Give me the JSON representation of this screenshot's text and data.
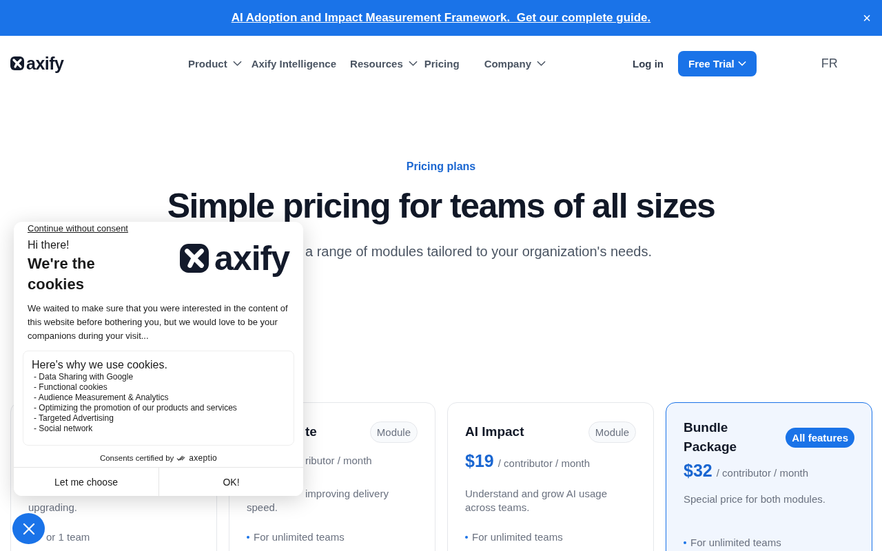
{
  "banner": {
    "link": "AI Adoption and Impact Measurement Framework.  Get our complete guide.",
    "close": "×"
  },
  "nav": {
    "logo": "axify",
    "items": [
      {
        "label": "Product",
        "dropdown": true
      },
      {
        "label": "Axify Intelligence",
        "dropdown": false
      },
      {
        "label": "Resources",
        "dropdown": true
      },
      {
        "label": "Pricing",
        "dropdown": false
      },
      {
        "label": "Company",
        "dropdown": true
      }
    ],
    "login": "Log in",
    "trial": "Free Trial",
    "language": "FR"
  },
  "hero": {
    "eyebrow": "Pricing plans",
    "title": "Simple pricing for teams of all sizes",
    "subtitle": "a range of modules tailored to your organization's needs."
  },
  "plans": [
    {
      "highlighted": false,
      "description": [
        "upgrading."
      ],
      "features": [
        "or 1 team"
      ]
    },
    {
      "highlighted": false,
      "title": "te",
      "badge": {
        "label": "Module",
        "kind": "outline"
      },
      "unit": "ributor / month",
      "description": [
        "improving delivery",
        "speed."
      ],
      "features": [
        "For unlimited teams"
      ]
    },
    {
      "highlighted": false,
      "title": "AI Impact",
      "badge": {
        "label": "Module",
        "kind": "outline"
      },
      "price": "$19",
      "unit": "/ contributor / month",
      "description": [
        "Understand and grow AI usage",
        "across teams."
      ],
      "features": [
        "For unlimited teams"
      ]
    },
    {
      "highlighted": true,
      "title": "Bundle Package",
      "badge": {
        "label": "All features",
        "kind": "solid"
      },
      "price": "$32",
      "unit": "/ contributor / month",
      "description": [
        "Special price for both modules."
      ],
      "features": [
        "For unlimited teams"
      ]
    }
  ],
  "consent": {
    "skip": "Continue without consent",
    "greeting": "Hi there!",
    "title": "We're the cookies",
    "logo": "axify",
    "intro": "We waited to make sure that you were interested in the content of this website before bothering you, but we would love to be your companions during your visit...",
    "reasons_title": "Here's why we use cookies.",
    "reasons": [
      "- Data Sharing with Google",
      "- Functional cookies",
      "- Audience Measurement & Analytics",
      "- Optimizing the promotion of our products and services",
      "- Targeted Advertising",
      "- Social network"
    ],
    "certified": "Consents certified by",
    "certifier": "axeptio",
    "buttons": [
      {
        "label": "Let me choose"
      },
      {
        "label": "OK!"
      }
    ]
  }
}
